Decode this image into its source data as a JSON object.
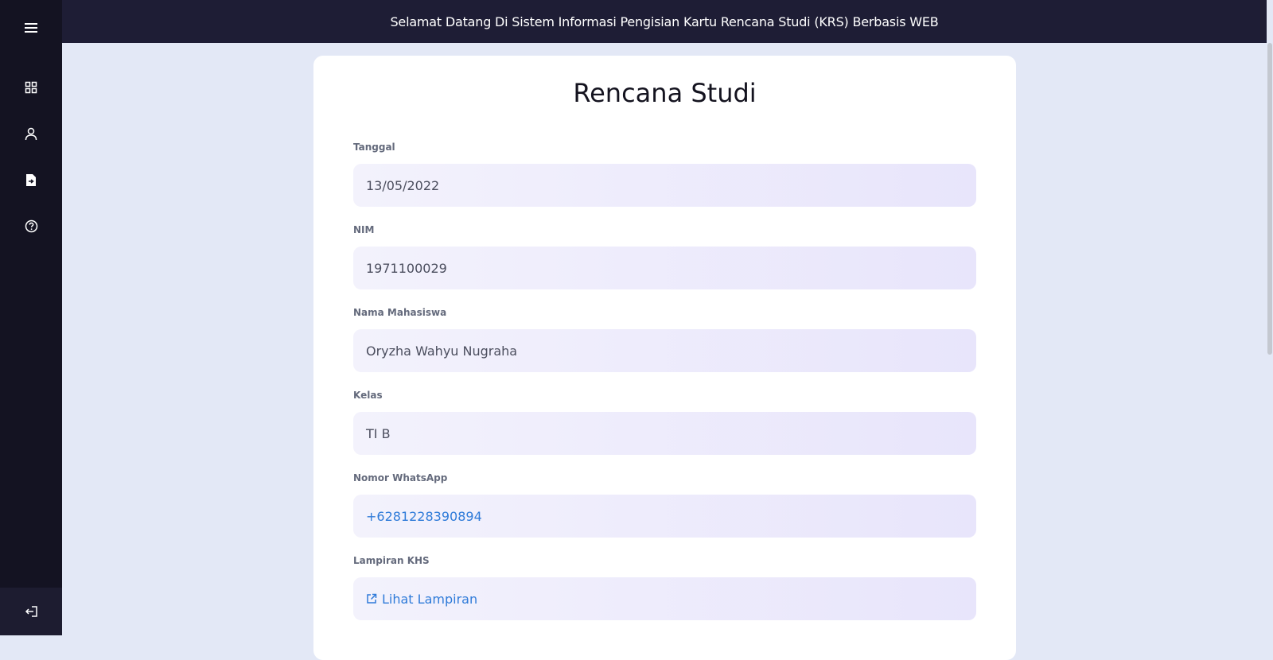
{
  "header": {
    "title": "Selamat Datang Di Sistem Informasi Pengisian Kartu Rencana Studi (KRS) Berbasis WEB"
  },
  "sidebar": {
    "items": [
      {
        "icon": "menu-icon"
      },
      {
        "icon": "dashboard-icon"
      },
      {
        "icon": "user-icon"
      },
      {
        "icon": "document-icon"
      },
      {
        "icon": "help-icon"
      }
    ],
    "logout_icon": "logout-icon"
  },
  "card": {
    "title": "Rencana Studi",
    "fields": [
      {
        "label": "Tanggal",
        "value": "13/05/2022"
      },
      {
        "label": "NIM",
        "value": "1971100029"
      },
      {
        "label": "Nama Mahasiswa",
        "value": "Oryzha Wahyu Nugraha"
      },
      {
        "label": "Kelas",
        "value": "TI B"
      },
      {
        "label": "Nomor WhatsApp",
        "value": "+6281228390894"
      },
      {
        "label": "Lampiran KHS",
        "value": "Lihat Lampiran"
      }
    ]
  },
  "colors": {
    "sidebar": "#141322",
    "header": "#1e1d35",
    "background": "#e3e8f6",
    "link": "#2f7bd9"
  }
}
